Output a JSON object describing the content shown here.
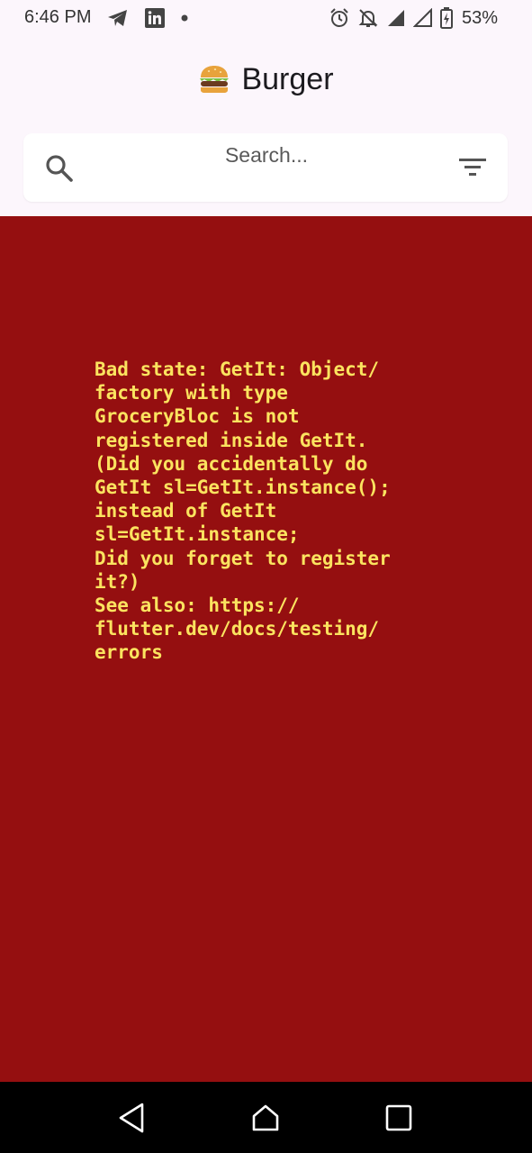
{
  "status_bar": {
    "time": "6:46 PM",
    "battery": "53%",
    "icons_left": [
      "telegram-icon",
      "linkedin-icon",
      "notification-dot-icon"
    ],
    "icons_right": [
      "alarm-icon",
      "notifications-off-icon",
      "signal-icon",
      "signal-outline-icon",
      "battery-charging-icon"
    ]
  },
  "header": {
    "emoji_icon": "burger-icon",
    "title": "Burger"
  },
  "search": {
    "placeholder": "Search...",
    "value": "",
    "search_icon": "search-icon",
    "filter_icon": "filter-icon"
  },
  "error": {
    "message": "Bad state: GetIt: Object/\nfactory with type\nGroceryBloc is not\nregistered inside GetIt.\n(Did you accidentally do\nGetIt sl=GetIt.instance();\ninstead of GetIt\nsl=GetIt.instance;\nDid you forget to register\nit?)\nSee also: https://\nflutter.dev/docs/testing/\nerrors"
  },
  "nav_bar": {
    "buttons": [
      "back-icon",
      "home-icon",
      "recents-icon"
    ]
  },
  "colors": {
    "background": "#fcf6fc",
    "error_background": "#950f10",
    "error_text": "#fbe35f",
    "search_card": "#ffffff",
    "nav_bar": "#000000"
  }
}
